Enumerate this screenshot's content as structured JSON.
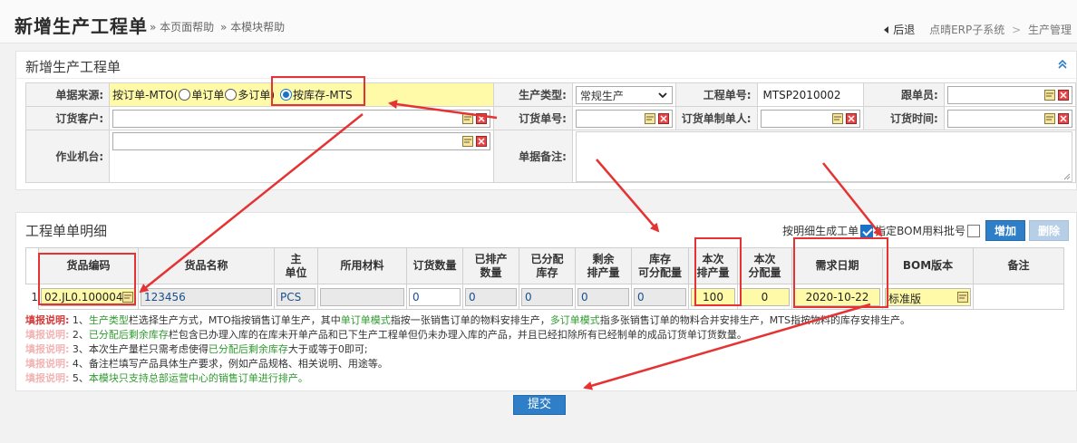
{
  "header": {
    "title": "新增生产工程单",
    "help_page": "» 本页面帮助",
    "help_module": "» 本模块帮助",
    "back": "后退",
    "crumb1": "点晴ERP子系统",
    "crumb_sep": ">",
    "crumb2": "生产管理"
  },
  "form": {
    "title": "新增生产工程单",
    "source_label": "单据来源:",
    "source_text1": "按订单-MTO(",
    "source_opt1": "单订单",
    "source_opt2": "多订单)",
    "source_opt3": "按库存-MTS",
    "prod_type_label": "生产类型:",
    "prod_type_value": "常规生产",
    "order_no_label": "工程单号:",
    "order_no_value": "MTSP2010002",
    "follower_label": "跟单员:",
    "customer_label": "订货客户:",
    "purchase_no_label": "订货单号:",
    "purchase_maker_label": "订货单制单人:",
    "purchase_time_label": "订货时间:",
    "machine_label": "作业机台:",
    "remark_label": "单据备注:"
  },
  "detail": {
    "title": "工程单单明细",
    "by_detail_label": "按明细生成工单",
    "bom_label": "指定BOM用料批号",
    "add_button": "增加",
    "delete_button": "删除",
    "columns": [
      "货品编码",
      "货品名称",
      "主\n单位",
      "所用材料",
      "订货数量",
      "已排产\n数量",
      "已分配\n库存",
      "剩余\n排产量",
      "库存\n可分配量",
      "本次\n排产量",
      "本次\n分配量",
      "需求日期",
      "BOM版本",
      "备注"
    ],
    "row": {
      "index": "1",
      "code": "02.JL0.100004",
      "name": "123456",
      "unit": "PCS",
      "material": "",
      "order_qty": "0",
      "scheduled_qty": "0",
      "allocated_stock": "0",
      "remaining_qty": "0",
      "stock_available": "0",
      "this_schedule": "100",
      "this_allocate": "0",
      "demand_date": "2020-10-22",
      "bom_version": "标准版",
      "note": ""
    }
  },
  "notes": {
    "label": "填报说明:",
    "n1a": "1、",
    "n1b": "生产类型",
    "n1c": "栏选择生产方式，MTO指按销售订单生产，其中",
    "n1d": "单订单模式",
    "n1e": "指按一张销售订单的物料安排生产，",
    "n1f": "多订单模式",
    "n1g": "指多张销售订单的物料合并安排生产，MTS指按物料的库存安排生产。",
    "n2a": "2、",
    "n2b": "已分配后剩余库存",
    "n2c": "栏包含已办理入库的在库未开单产品和已下生产工程单但仍未办理入库的产品，并且已经扣除所有已经制单的成品订货单订货数量。",
    "n3a": "3、本次生产量栏只需考虑使得",
    "n3b": "已分配后剩余库存",
    "n3c": "大于或等于0即可;",
    "n4": "4、备注栏填写产品具体生产要求，例如产品规格、相关说明、用途等。",
    "n5a": "5、",
    "n5b": "本模块只支持总部运营中心的销售订单进行排产。"
  },
  "submit_label": "提交",
  "colors": {
    "accent": "#2f7fc8",
    "highlight": "#fffaa8",
    "annotation": "#e53333",
    "green_text": "#2f9a2f",
    "red_label": "#d23b3b"
  }
}
